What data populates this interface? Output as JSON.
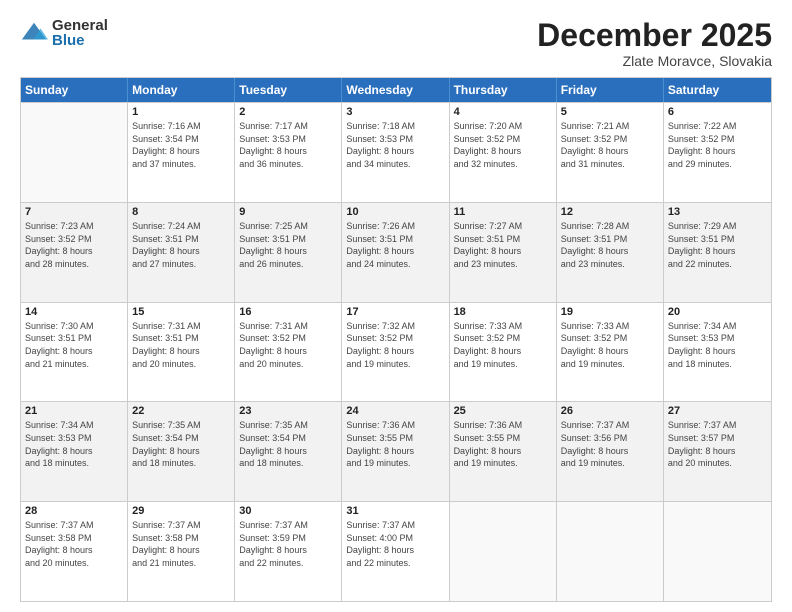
{
  "logo": {
    "general": "General",
    "blue": "Blue"
  },
  "title": "December 2025",
  "subtitle": "Zlate Moravce, Slovakia",
  "headers": [
    "Sunday",
    "Monday",
    "Tuesday",
    "Wednesday",
    "Thursday",
    "Friday",
    "Saturday"
  ],
  "weeks": [
    [
      {
        "day": "",
        "info": ""
      },
      {
        "day": "1",
        "info": "Sunrise: 7:16 AM\nSunset: 3:54 PM\nDaylight: 8 hours\nand 37 minutes."
      },
      {
        "day": "2",
        "info": "Sunrise: 7:17 AM\nSunset: 3:53 PM\nDaylight: 8 hours\nand 36 minutes."
      },
      {
        "day": "3",
        "info": "Sunrise: 7:18 AM\nSunset: 3:53 PM\nDaylight: 8 hours\nand 34 minutes."
      },
      {
        "day": "4",
        "info": "Sunrise: 7:20 AM\nSunset: 3:52 PM\nDaylight: 8 hours\nand 32 minutes."
      },
      {
        "day": "5",
        "info": "Sunrise: 7:21 AM\nSunset: 3:52 PM\nDaylight: 8 hours\nand 31 minutes."
      },
      {
        "day": "6",
        "info": "Sunrise: 7:22 AM\nSunset: 3:52 PM\nDaylight: 8 hours\nand 29 minutes."
      }
    ],
    [
      {
        "day": "7",
        "info": "Sunrise: 7:23 AM\nSunset: 3:52 PM\nDaylight: 8 hours\nand 28 minutes."
      },
      {
        "day": "8",
        "info": "Sunrise: 7:24 AM\nSunset: 3:51 PM\nDaylight: 8 hours\nand 27 minutes."
      },
      {
        "day": "9",
        "info": "Sunrise: 7:25 AM\nSunset: 3:51 PM\nDaylight: 8 hours\nand 26 minutes."
      },
      {
        "day": "10",
        "info": "Sunrise: 7:26 AM\nSunset: 3:51 PM\nDaylight: 8 hours\nand 24 minutes."
      },
      {
        "day": "11",
        "info": "Sunrise: 7:27 AM\nSunset: 3:51 PM\nDaylight: 8 hours\nand 23 minutes."
      },
      {
        "day": "12",
        "info": "Sunrise: 7:28 AM\nSunset: 3:51 PM\nDaylight: 8 hours\nand 23 minutes."
      },
      {
        "day": "13",
        "info": "Sunrise: 7:29 AM\nSunset: 3:51 PM\nDaylight: 8 hours\nand 22 minutes."
      }
    ],
    [
      {
        "day": "14",
        "info": "Sunrise: 7:30 AM\nSunset: 3:51 PM\nDaylight: 8 hours\nand 21 minutes."
      },
      {
        "day": "15",
        "info": "Sunrise: 7:31 AM\nSunset: 3:51 PM\nDaylight: 8 hours\nand 20 minutes."
      },
      {
        "day": "16",
        "info": "Sunrise: 7:31 AM\nSunset: 3:52 PM\nDaylight: 8 hours\nand 20 minutes."
      },
      {
        "day": "17",
        "info": "Sunrise: 7:32 AM\nSunset: 3:52 PM\nDaylight: 8 hours\nand 19 minutes."
      },
      {
        "day": "18",
        "info": "Sunrise: 7:33 AM\nSunset: 3:52 PM\nDaylight: 8 hours\nand 19 minutes."
      },
      {
        "day": "19",
        "info": "Sunrise: 7:33 AM\nSunset: 3:52 PM\nDaylight: 8 hours\nand 19 minutes."
      },
      {
        "day": "20",
        "info": "Sunrise: 7:34 AM\nSunset: 3:53 PM\nDaylight: 8 hours\nand 18 minutes."
      }
    ],
    [
      {
        "day": "21",
        "info": "Sunrise: 7:34 AM\nSunset: 3:53 PM\nDaylight: 8 hours\nand 18 minutes."
      },
      {
        "day": "22",
        "info": "Sunrise: 7:35 AM\nSunset: 3:54 PM\nDaylight: 8 hours\nand 18 minutes."
      },
      {
        "day": "23",
        "info": "Sunrise: 7:35 AM\nSunset: 3:54 PM\nDaylight: 8 hours\nand 18 minutes."
      },
      {
        "day": "24",
        "info": "Sunrise: 7:36 AM\nSunset: 3:55 PM\nDaylight: 8 hours\nand 19 minutes."
      },
      {
        "day": "25",
        "info": "Sunrise: 7:36 AM\nSunset: 3:55 PM\nDaylight: 8 hours\nand 19 minutes."
      },
      {
        "day": "26",
        "info": "Sunrise: 7:37 AM\nSunset: 3:56 PM\nDaylight: 8 hours\nand 19 minutes."
      },
      {
        "day": "27",
        "info": "Sunrise: 7:37 AM\nSunset: 3:57 PM\nDaylight: 8 hours\nand 20 minutes."
      }
    ],
    [
      {
        "day": "28",
        "info": "Sunrise: 7:37 AM\nSunset: 3:58 PM\nDaylight: 8 hours\nand 20 minutes."
      },
      {
        "day": "29",
        "info": "Sunrise: 7:37 AM\nSunset: 3:58 PM\nDaylight: 8 hours\nand 21 minutes."
      },
      {
        "day": "30",
        "info": "Sunrise: 7:37 AM\nSunset: 3:59 PM\nDaylight: 8 hours\nand 22 minutes."
      },
      {
        "day": "31",
        "info": "Sunrise: 7:37 AM\nSunset: 4:00 PM\nDaylight: 8 hours\nand 22 minutes."
      },
      {
        "day": "",
        "info": ""
      },
      {
        "day": "",
        "info": ""
      },
      {
        "day": "",
        "info": ""
      }
    ]
  ]
}
